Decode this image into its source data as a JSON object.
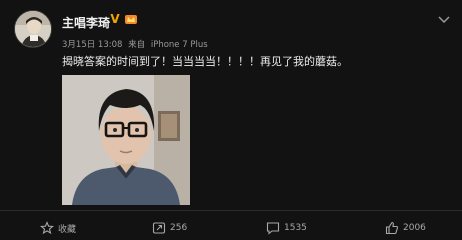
{
  "post": {
    "username": "主唱李琦",
    "verified_badge": "V",
    "timestamp": "3月15日 13:08",
    "source_prefix": "来自",
    "source_device": "iPhone 7 Plus",
    "text": "揭晓答案的时间到了！当当当当！！！！再见了我的蘑菇。"
  },
  "actions": {
    "favorite": {
      "icon": "star-icon",
      "label": "收藏"
    },
    "repost": {
      "icon": "repost-icon",
      "count": "256"
    },
    "comment": {
      "icon": "comment-icon",
      "count": "1535"
    },
    "like": {
      "icon": "thumbs-up-icon",
      "count": "2006"
    }
  },
  "colors": {
    "background": "#121212",
    "text": "#ececec",
    "meta": "#9a9a9a",
    "badge": "#f5a400"
  }
}
